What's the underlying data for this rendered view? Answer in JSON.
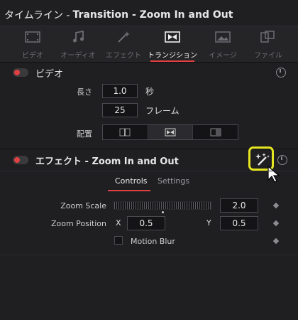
{
  "title": {
    "prefix": "タイムライン -",
    "main": "Transition - Zoom In and Out"
  },
  "tabs": [
    {
      "label": "ビデオ",
      "icon": "video-frame-icon",
      "active": false
    },
    {
      "label": "オーディオ",
      "icon": "music-note-icon",
      "active": false
    },
    {
      "label": "エフェクト",
      "icon": "magic-wand-icon",
      "active": false
    },
    {
      "label": "トランジション",
      "icon": "transition-icon",
      "active": true
    },
    {
      "label": "イメージ",
      "icon": "image-icon",
      "active": false
    },
    {
      "label": "ファイル",
      "icon": "file-icon",
      "active": false
    }
  ],
  "video_section": {
    "title": "ビデオ",
    "duration_label": "長さ",
    "duration_seconds": "1.0",
    "seconds_unit": "秒",
    "duration_frames": "25",
    "frames_unit": "フレーム",
    "alignment_label": "配置"
  },
  "effect_section": {
    "title": "エフェクト - Zoom In and Out"
  },
  "subtabs": {
    "controls": "Controls",
    "settings": "Settings"
  },
  "controls": {
    "zoom_scale_label": "Zoom Scale",
    "zoom_scale_value": "2.0",
    "zoom_position_label": "Zoom Position",
    "x_label": "X",
    "x_value": "0.5",
    "y_label": "Y",
    "y_value": "0.5",
    "motion_blur_label": "Motion Blur",
    "motion_blur_checked": false
  },
  "colors": {
    "accent": "#e04040",
    "highlight": "#e6e620"
  }
}
